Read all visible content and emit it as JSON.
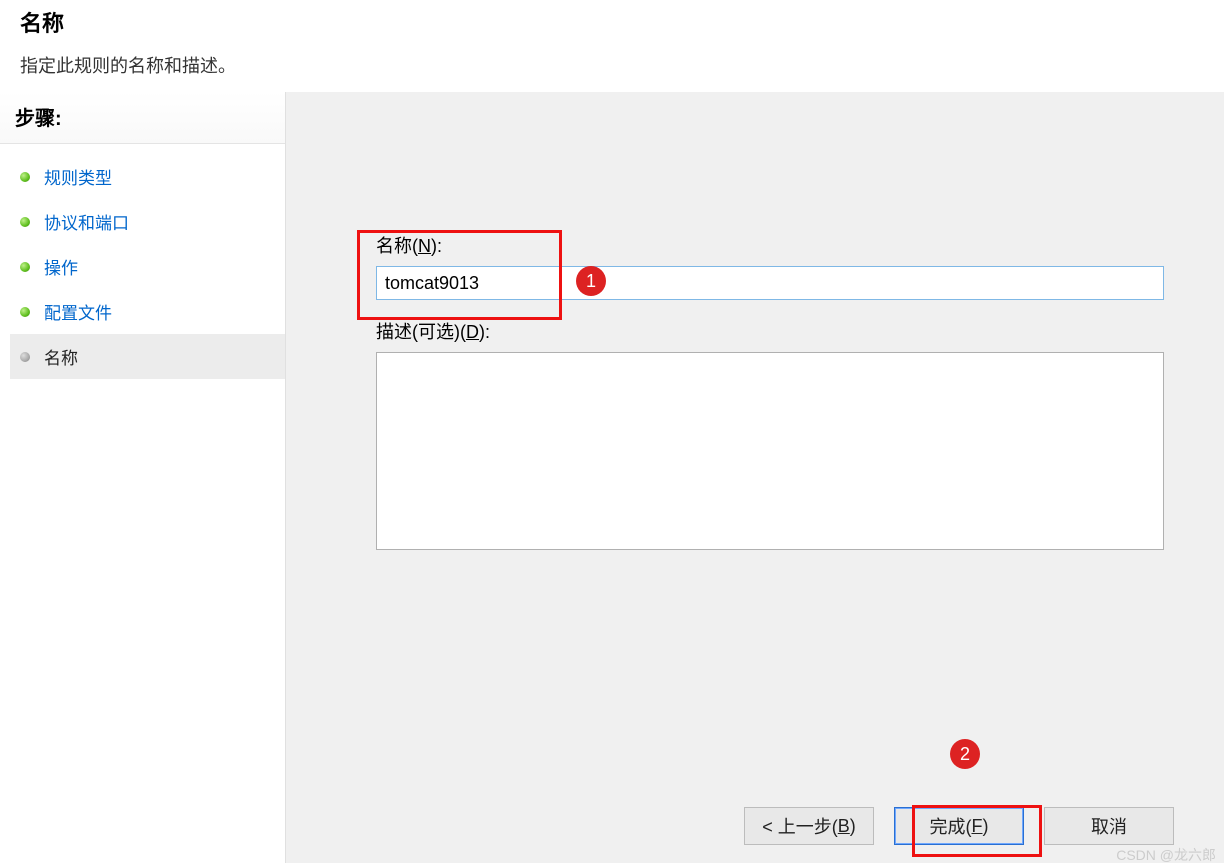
{
  "header": {
    "title": "名称",
    "desc": "指定此规则的名称和描述。"
  },
  "sidebar": {
    "title": "步骤:",
    "items": [
      {
        "label": "规则类型"
      },
      {
        "label": "协议和端口"
      },
      {
        "label": "操作"
      },
      {
        "label": "配置文件"
      },
      {
        "label": "名称"
      }
    ],
    "current_index": 4
  },
  "form": {
    "name_label_pre": "名称(",
    "name_label_u": "N",
    "name_label_post": "):",
    "name_value": "tomcat9013",
    "desc_label_pre": "描述(可选)(",
    "desc_label_u": "D",
    "desc_label_post": "):",
    "desc_value": ""
  },
  "buttons": {
    "back_pre": "< 上一步(",
    "back_u": "B",
    "back_post": ")",
    "finish_pre": "完成(",
    "finish_u": "F",
    "finish_post": ")",
    "cancel": "取消"
  },
  "annotations": {
    "badge1": "1",
    "badge2": "2"
  },
  "watermark": "CSDN @龙六郎"
}
